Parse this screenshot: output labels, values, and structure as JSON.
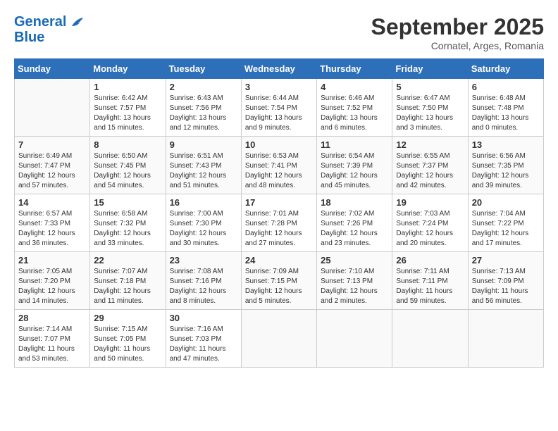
{
  "header": {
    "logo_line1": "General",
    "logo_line2": "Blue",
    "month": "September 2025",
    "location": "Cornatel, Arges, Romania"
  },
  "weekdays": [
    "Sunday",
    "Monday",
    "Tuesday",
    "Wednesday",
    "Thursday",
    "Friday",
    "Saturday"
  ],
  "weeks": [
    [
      {
        "day": "",
        "sunrise": "",
        "sunset": "",
        "daylight": ""
      },
      {
        "day": "1",
        "sunrise": "Sunrise: 6:42 AM",
        "sunset": "Sunset: 7:57 PM",
        "daylight": "Daylight: 13 hours and 15 minutes."
      },
      {
        "day": "2",
        "sunrise": "Sunrise: 6:43 AM",
        "sunset": "Sunset: 7:56 PM",
        "daylight": "Daylight: 13 hours and 12 minutes."
      },
      {
        "day": "3",
        "sunrise": "Sunrise: 6:44 AM",
        "sunset": "Sunset: 7:54 PM",
        "daylight": "Daylight: 13 hours and 9 minutes."
      },
      {
        "day": "4",
        "sunrise": "Sunrise: 6:46 AM",
        "sunset": "Sunset: 7:52 PM",
        "daylight": "Daylight: 13 hours and 6 minutes."
      },
      {
        "day": "5",
        "sunrise": "Sunrise: 6:47 AM",
        "sunset": "Sunset: 7:50 PM",
        "daylight": "Daylight: 13 hours and 3 minutes."
      },
      {
        "day": "6",
        "sunrise": "Sunrise: 6:48 AM",
        "sunset": "Sunset: 7:48 PM",
        "daylight": "Daylight: 13 hours and 0 minutes."
      }
    ],
    [
      {
        "day": "7",
        "sunrise": "Sunrise: 6:49 AM",
        "sunset": "Sunset: 7:47 PM",
        "daylight": "Daylight: 12 hours and 57 minutes."
      },
      {
        "day": "8",
        "sunrise": "Sunrise: 6:50 AM",
        "sunset": "Sunset: 7:45 PM",
        "daylight": "Daylight: 12 hours and 54 minutes."
      },
      {
        "day": "9",
        "sunrise": "Sunrise: 6:51 AM",
        "sunset": "Sunset: 7:43 PM",
        "daylight": "Daylight: 12 hours and 51 minutes."
      },
      {
        "day": "10",
        "sunrise": "Sunrise: 6:53 AM",
        "sunset": "Sunset: 7:41 PM",
        "daylight": "Daylight: 12 hours and 48 minutes."
      },
      {
        "day": "11",
        "sunrise": "Sunrise: 6:54 AM",
        "sunset": "Sunset: 7:39 PM",
        "daylight": "Daylight: 12 hours and 45 minutes."
      },
      {
        "day": "12",
        "sunrise": "Sunrise: 6:55 AM",
        "sunset": "Sunset: 7:37 PM",
        "daylight": "Daylight: 12 hours and 42 minutes."
      },
      {
        "day": "13",
        "sunrise": "Sunrise: 6:56 AM",
        "sunset": "Sunset: 7:35 PM",
        "daylight": "Daylight: 12 hours and 39 minutes."
      }
    ],
    [
      {
        "day": "14",
        "sunrise": "Sunrise: 6:57 AM",
        "sunset": "Sunset: 7:33 PM",
        "daylight": "Daylight: 12 hours and 36 minutes."
      },
      {
        "day": "15",
        "sunrise": "Sunrise: 6:58 AM",
        "sunset": "Sunset: 7:32 PM",
        "daylight": "Daylight: 12 hours and 33 minutes."
      },
      {
        "day": "16",
        "sunrise": "Sunrise: 7:00 AM",
        "sunset": "Sunset: 7:30 PM",
        "daylight": "Daylight: 12 hours and 30 minutes."
      },
      {
        "day": "17",
        "sunrise": "Sunrise: 7:01 AM",
        "sunset": "Sunset: 7:28 PM",
        "daylight": "Daylight: 12 hours and 27 minutes."
      },
      {
        "day": "18",
        "sunrise": "Sunrise: 7:02 AM",
        "sunset": "Sunset: 7:26 PM",
        "daylight": "Daylight: 12 hours and 23 minutes."
      },
      {
        "day": "19",
        "sunrise": "Sunrise: 7:03 AM",
        "sunset": "Sunset: 7:24 PM",
        "daylight": "Daylight: 12 hours and 20 minutes."
      },
      {
        "day": "20",
        "sunrise": "Sunrise: 7:04 AM",
        "sunset": "Sunset: 7:22 PM",
        "daylight": "Daylight: 12 hours and 17 minutes."
      }
    ],
    [
      {
        "day": "21",
        "sunrise": "Sunrise: 7:05 AM",
        "sunset": "Sunset: 7:20 PM",
        "daylight": "Daylight: 12 hours and 14 minutes."
      },
      {
        "day": "22",
        "sunrise": "Sunrise: 7:07 AM",
        "sunset": "Sunset: 7:18 PM",
        "daylight": "Daylight: 12 hours and 11 minutes."
      },
      {
        "day": "23",
        "sunrise": "Sunrise: 7:08 AM",
        "sunset": "Sunset: 7:16 PM",
        "daylight": "Daylight: 12 hours and 8 minutes."
      },
      {
        "day": "24",
        "sunrise": "Sunrise: 7:09 AM",
        "sunset": "Sunset: 7:15 PM",
        "daylight": "Daylight: 12 hours and 5 minutes."
      },
      {
        "day": "25",
        "sunrise": "Sunrise: 7:10 AM",
        "sunset": "Sunset: 7:13 PM",
        "daylight": "Daylight: 12 hours and 2 minutes."
      },
      {
        "day": "26",
        "sunrise": "Sunrise: 7:11 AM",
        "sunset": "Sunset: 7:11 PM",
        "daylight": "Daylight: 11 hours and 59 minutes."
      },
      {
        "day": "27",
        "sunrise": "Sunrise: 7:13 AM",
        "sunset": "Sunset: 7:09 PM",
        "daylight": "Daylight: 11 hours and 56 minutes."
      }
    ],
    [
      {
        "day": "28",
        "sunrise": "Sunrise: 7:14 AM",
        "sunset": "Sunset: 7:07 PM",
        "daylight": "Daylight: 11 hours and 53 minutes."
      },
      {
        "day": "29",
        "sunrise": "Sunrise: 7:15 AM",
        "sunset": "Sunset: 7:05 PM",
        "daylight": "Daylight: 11 hours and 50 minutes."
      },
      {
        "day": "30",
        "sunrise": "Sunrise: 7:16 AM",
        "sunset": "Sunset: 7:03 PM",
        "daylight": "Daylight: 11 hours and 47 minutes."
      },
      {
        "day": "",
        "sunrise": "",
        "sunset": "",
        "daylight": ""
      },
      {
        "day": "",
        "sunrise": "",
        "sunset": "",
        "daylight": ""
      },
      {
        "day": "",
        "sunrise": "",
        "sunset": "",
        "daylight": ""
      },
      {
        "day": "",
        "sunrise": "",
        "sunset": "",
        "daylight": ""
      }
    ]
  ]
}
